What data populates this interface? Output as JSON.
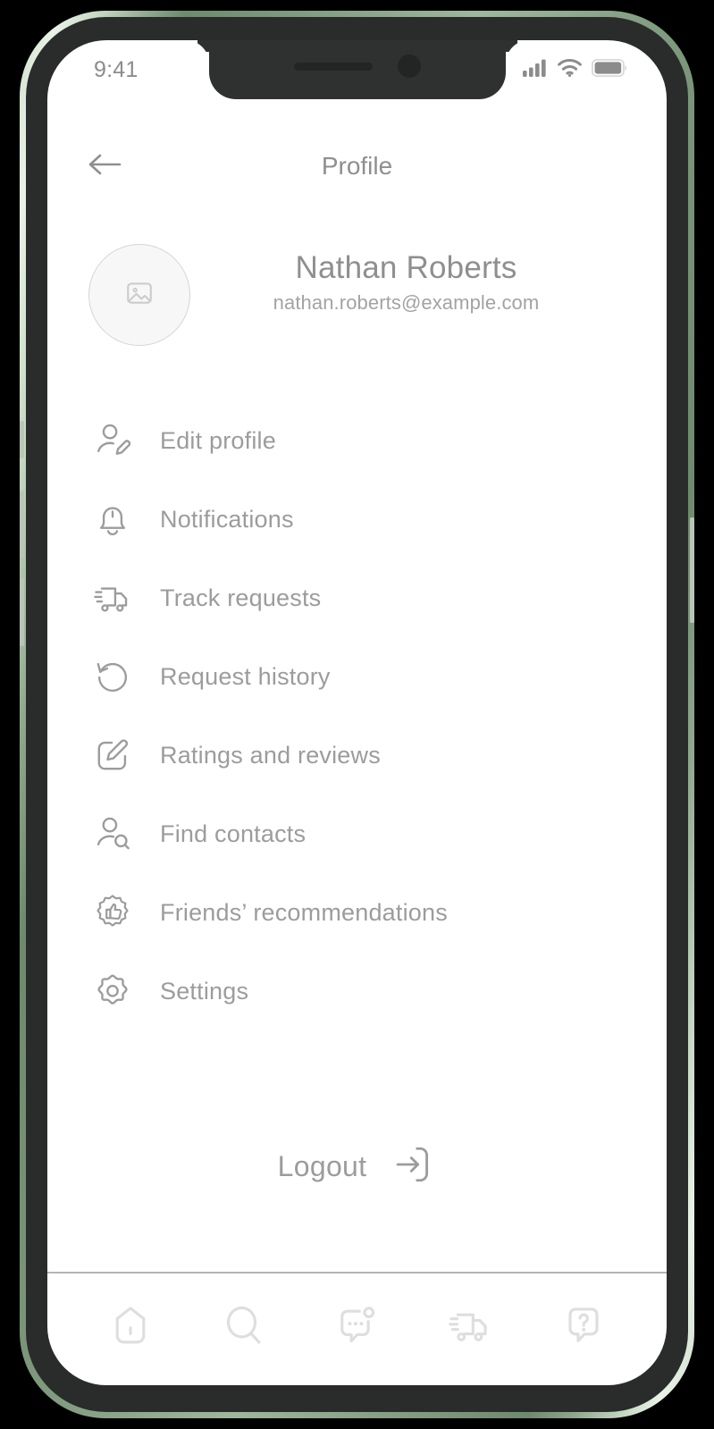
{
  "status_bar": {
    "time": "9:41",
    "icons": [
      "cellular-signal-icon",
      "wifi-icon",
      "battery-icon"
    ]
  },
  "header": {
    "title": "Profile",
    "back_icon": "arrow-left-icon"
  },
  "profile": {
    "avatar_icon": "image-placeholder-icon",
    "name": "Nathan Roberts",
    "email": "nathan.roberts@example.com"
  },
  "menu": {
    "items": [
      {
        "label": "Edit profile",
        "icon": "user-edit-icon"
      },
      {
        "label": "Notifications",
        "icon": "bell-icon"
      },
      {
        "label": "Track requests",
        "icon": "delivery-truck-icon"
      },
      {
        "label": "Request history",
        "icon": "history-rotate-left-icon"
      },
      {
        "label": "Ratings and reviews",
        "icon": "pencil-square-icon"
      },
      {
        "label": "Find contacts",
        "icon": "user-search-icon"
      },
      {
        "label": "Friends’ recommendations",
        "icon": "thumbs-up-badge-icon"
      },
      {
        "label": "Settings",
        "icon": "gear-icon"
      }
    ]
  },
  "logout": {
    "label": "Logout",
    "icon": "logout-arrow-icon"
  },
  "bottom_nav": {
    "items": [
      {
        "name": "home",
        "icon": "home-icon"
      },
      {
        "name": "search",
        "icon": "search-icon"
      },
      {
        "name": "chat",
        "icon": "chat-bubble-dot-icon"
      },
      {
        "name": "delivery",
        "icon": "delivery-truck-icon"
      },
      {
        "name": "help",
        "icon": "help-question-bubble-icon"
      }
    ]
  },
  "colors": {
    "screen_background": "#ffffff",
    "primary_text": "#9c9c9c",
    "secondary_text": "#a3a3a3",
    "title_text": "#8f8f8f",
    "icon_stroke": "#9c9c9c",
    "nav_icon_stroke": "#dedede",
    "divider": "#b4b4b4",
    "avatar_fill": "#f7f7f7",
    "phone_body": "#2a2c2b",
    "phone_edge": "#9fb79d"
  }
}
